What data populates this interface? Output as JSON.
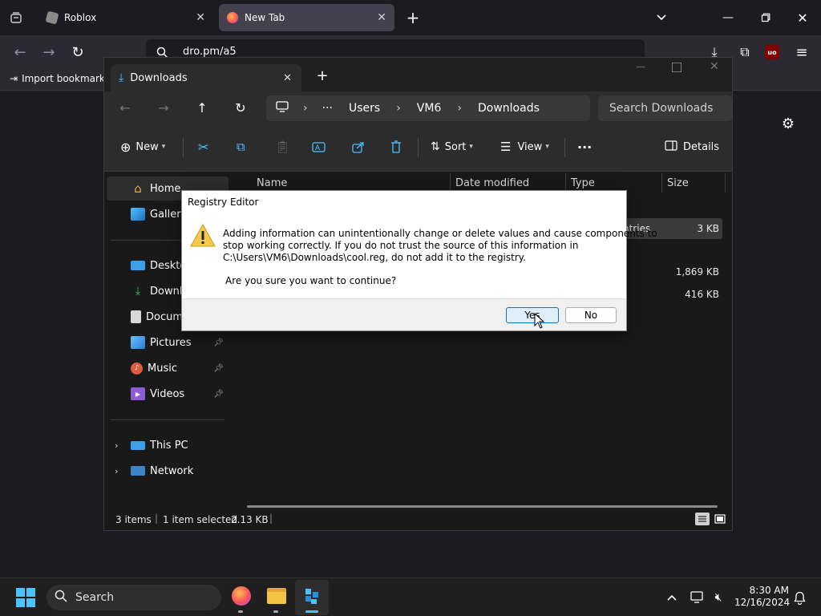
{
  "browser": {
    "tabs": [
      {
        "title": "Roblox",
        "active": false
      },
      {
        "title": "New Tab",
        "active": true
      }
    ],
    "url": "dro.pm/a5",
    "bookmark": "Import bookmarks"
  },
  "explorer": {
    "tab_title": "Downloads",
    "breadcrumb": [
      "Users",
      "VM6",
      "Downloads"
    ],
    "search_placeholder": "Search Downloads",
    "toolbar": {
      "new": "New",
      "sort": "Sort",
      "view": "View",
      "details": "Details"
    },
    "nav": [
      {
        "label": "Home",
        "pinned": false
      },
      {
        "label": "Gallery",
        "pinned": false
      },
      {
        "label": "Desktop",
        "pinned": true
      },
      {
        "label": "Downloads",
        "pinned": true
      },
      {
        "label": "Documents",
        "pinned": true
      },
      {
        "label": "Pictures",
        "pinned": true
      },
      {
        "label": "Music",
        "pinned": true
      },
      {
        "label": "Videos",
        "pinned": true
      },
      {
        "label": "This PC",
        "pinned": false
      },
      {
        "label": "Network",
        "pinned": false
      }
    ],
    "columns": [
      "Name",
      "Date modified",
      "Type",
      "Size"
    ],
    "files": [
      {
        "type": "ntries",
        "size": "3 KB"
      },
      {
        "type": "",
        "size": "1,869 KB"
      },
      {
        "type": "",
        "size": "416 KB"
      }
    ],
    "status": {
      "items": "3 items",
      "selected": "1 item selected",
      "size": "2.13 KB"
    }
  },
  "dialog": {
    "title": "Registry Editor",
    "message_1": "Adding information can unintentionally change or delete values and cause components to",
    "message_2": "stop working correctly. If you do not trust the source of this information in",
    "message_3": "C:\\Users\\VM6\\Downloads\\cool.reg, do not add it to the registry.",
    "question": "Are you sure you want to continue?",
    "yes": "Yes",
    "no": "No"
  },
  "taskbar": {
    "search": "Search",
    "time": "8:30 AM",
    "date": "12/16/2024"
  },
  "colors": {
    "accent": "#4cc2ff",
    "dialog_button_focus": "#0078d4",
    "folder": "#f3c342"
  }
}
